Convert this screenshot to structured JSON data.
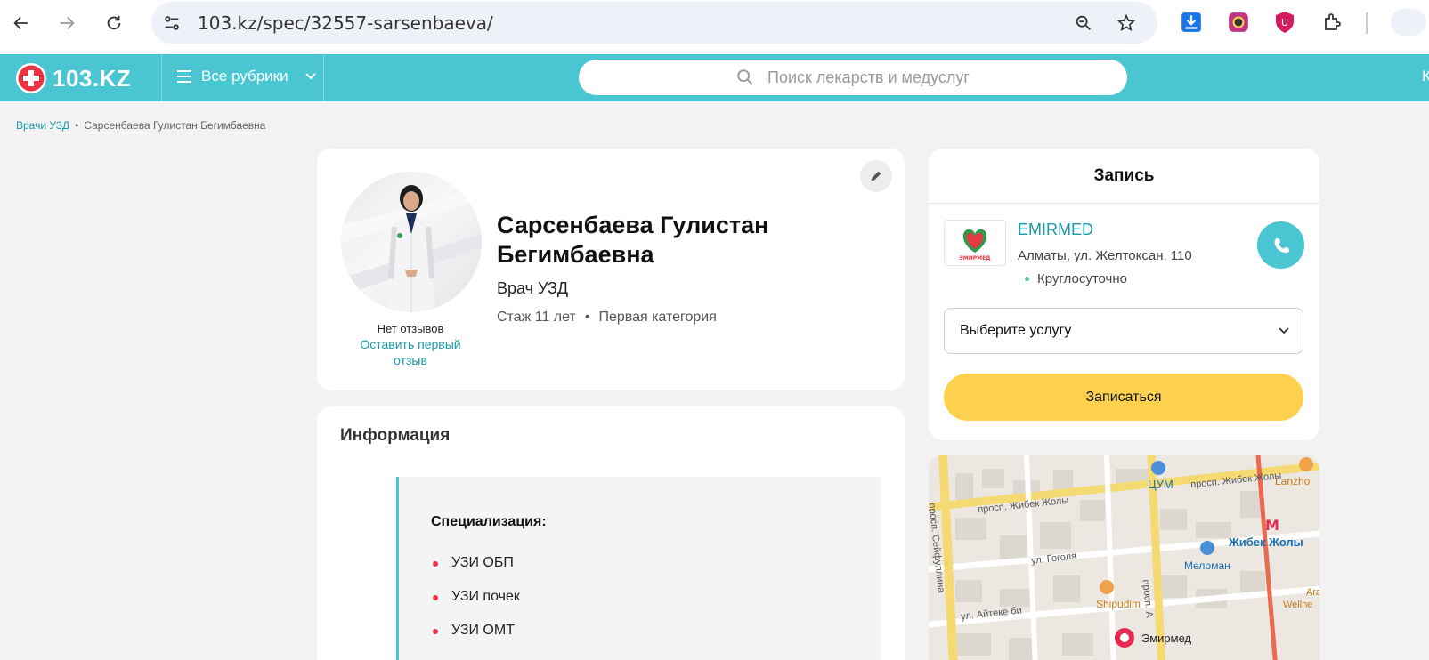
{
  "browser": {
    "url": "103.kz/spec/32557-sarsenbaeva/",
    "icons": [
      "back-icon",
      "forward-icon",
      "reload-icon",
      "site-settings-icon",
      "zoom-out-icon",
      "bookmark-star-icon",
      "download-icon",
      "extension-icon",
      "extension-icon",
      "puzzle-icon"
    ]
  },
  "header": {
    "logo_text": "103.KZ",
    "rubrics_label": "Все рубрики",
    "search_placeholder": "Поиск лекарств и медуслуг",
    "cut_text": "К",
    "accent_color": "#4ac6d3"
  },
  "breadcrumb": {
    "items": [
      "Врачи УЗД",
      "Сарсенбаева Гулистан Бегимбаевна"
    ],
    "separator": "•"
  },
  "doctor": {
    "name": "Сарсенбаева Гулистан Бегимбаевна",
    "specialty": "Врач УЗД",
    "experience": "Стаж 11 лет",
    "meta_separator": "•",
    "category": "Первая категория",
    "no_reviews": "Нет отзывов",
    "leave_review": "Оставить первый отзыв"
  },
  "info": {
    "title": "Информация",
    "spec_heading": "Специализация:",
    "spec_items": [
      "УЗИ ОБП",
      "УЗИ почек",
      "УЗИ ОМТ"
    ]
  },
  "booking": {
    "title": "Запись",
    "clinic_name": "EMIRMED",
    "clinic_logo_text": "ЭМИРМЕД",
    "clinic_address": "Алматы, ул. Желтоксан, 110",
    "clinic_hours": "Круглосуточно",
    "service_placeholder": "Выберите услугу",
    "book_button": "Записаться",
    "button_color": "#fdd14d"
  },
  "map": {
    "labels": [
      "просп. Жибек Жолы",
      "просп. Жибек Жолы",
      "просп. Сейфуллина",
      "ул. Гоголя",
      "ул. Айтеке би",
      "просп. А"
    ],
    "pois": [
      "ЦУМ",
      "Жибек Жолы",
      "Меломан",
      "Shipudim",
      "Эмирмед",
      "Lanzho",
      "Ara",
      "Wellne"
    ]
  }
}
